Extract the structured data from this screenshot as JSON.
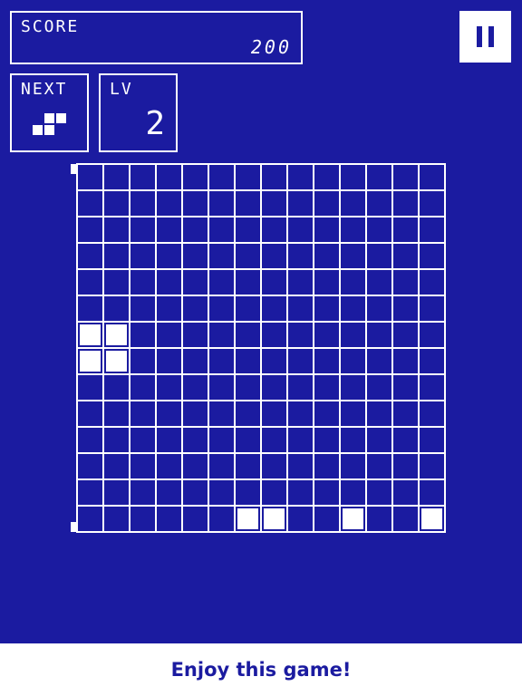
{
  "score": {
    "label": "SCORE",
    "value": "200"
  },
  "next": {
    "label": "NEXT",
    "piece": [
      [
        0,
        1,
        1
      ],
      [
        1,
        1,
        0
      ]
    ]
  },
  "level": {
    "label": "LV",
    "value": "2"
  },
  "pause": {
    "icon": "pause-icon"
  },
  "board": {
    "cols": 14,
    "rows": 14,
    "filled": [
      [
        6,
        0
      ],
      [
        6,
        1
      ],
      [
        7,
        0
      ],
      [
        7,
        1
      ],
      [
        13,
        6
      ],
      [
        13,
        7
      ],
      [
        13,
        10
      ],
      [
        13,
        13
      ]
    ]
  },
  "footer": {
    "text": "Enjoy this game!"
  },
  "colors": {
    "background": "#1b1ba0",
    "foreground": "#ffffff"
  }
}
